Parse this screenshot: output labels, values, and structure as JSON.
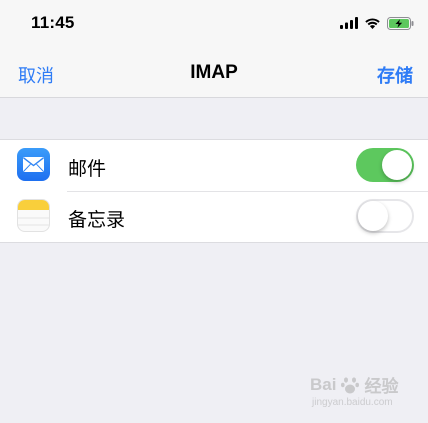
{
  "status_bar": {
    "time": "11:45",
    "icons": [
      "signal-icon",
      "wifi-icon",
      "battery-charging-icon"
    ]
  },
  "nav": {
    "cancel_label": "取消",
    "title": "IMAP",
    "save_label": "存储"
  },
  "list": {
    "items": [
      {
        "icon": "mail-app-icon",
        "label": "邮件",
        "enabled": true
      },
      {
        "icon": "notes-app-icon",
        "label": "备忘录",
        "enabled": false
      }
    ]
  },
  "colors": {
    "accent": "#2f7cf6",
    "toggle_on": "#5dc85e",
    "background": "#efeff4"
  },
  "watermark": {
    "brand": "Bai",
    "brand_cn": "经验",
    "url": "jingyan.baidu.com"
  }
}
